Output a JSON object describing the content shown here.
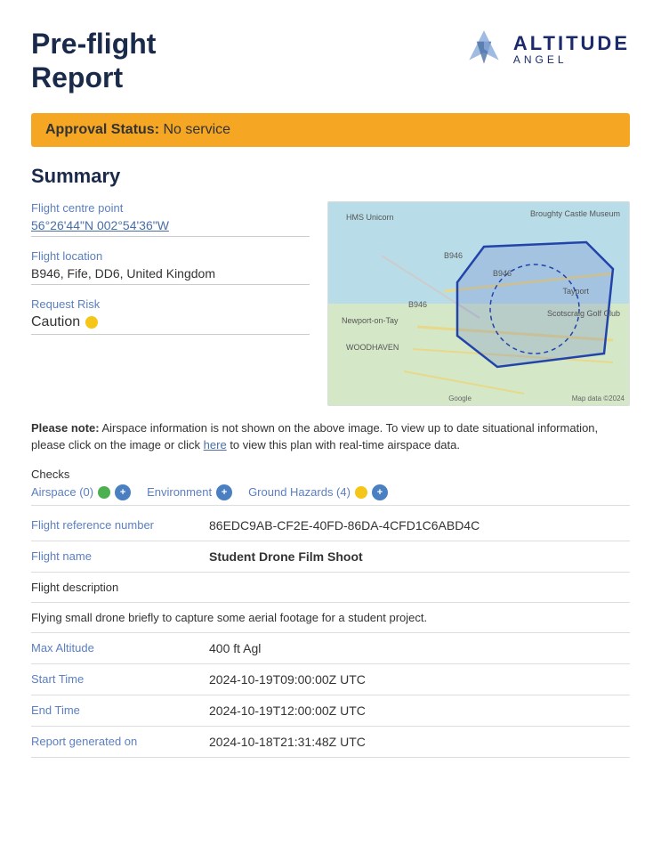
{
  "header": {
    "title_line1": "Pre-flight",
    "title_line2": "Report",
    "logo_altitude": "ALTITUDE",
    "logo_angel": "ANGEL"
  },
  "approval": {
    "label": "Approval Status:",
    "value": "No service"
  },
  "summary": {
    "title": "Summary",
    "fields": {
      "centre_label": "Flight centre point",
      "centre_value": "56°26'44\"N 002°54'36\"W",
      "location_label": "Flight location",
      "location_value": "B946, Fife, DD6, United Kingdom",
      "risk_label": "Request Risk",
      "risk_value": "Caution"
    }
  },
  "note": {
    "bold_part": "Please note:",
    "text": " Airspace information is not shown on the above image. To view up to date situational information, please click on the image or click ",
    "link_text": "here",
    "text_end": " to view this plan with real-time airspace data."
  },
  "checks": {
    "label": "Checks",
    "airspace_label": "Airspace (0)",
    "environment_label": "Environment",
    "ground_hazards_label": "Ground Hazards (4)"
  },
  "details": {
    "ref_label": "Flight reference number",
    "ref_value": "86EDC9AB-CF2E-40FD-86DA-4CFD1C6ABD4C",
    "name_label": "Flight name",
    "name_value": "Student Drone Film Shoot",
    "desc_label": "Flight description",
    "desc_value": "Flying small drone briefly to capture some aerial footage for a student project.",
    "altitude_label": "Max Altitude",
    "altitude_value": "400 ft Agl",
    "start_label": "Start Time",
    "start_value": "2024-10-19T09:00:00Z UTC",
    "end_label": "End Time",
    "end_value": "2024-10-19T12:00:00Z UTC",
    "generated_label": "Report generated on",
    "generated_value": "2024-10-18T21:31:48Z UTC"
  },
  "map": {
    "label_hms": "HMS Unicorn",
    "label_broughty": "Broughty Castle Museum",
    "label_newport": "Newport-on-Tay",
    "label_tayport": "Tayport",
    "label_scotscraig": "Scotscraig Golf Club",
    "label_woodhaven": "WOODHAVEN",
    "label_b946_1": "B946",
    "label_b946_2": "B946",
    "label_b946_3": "B946",
    "label_google": "Google",
    "label_mapdata": "Map data ©2024"
  }
}
